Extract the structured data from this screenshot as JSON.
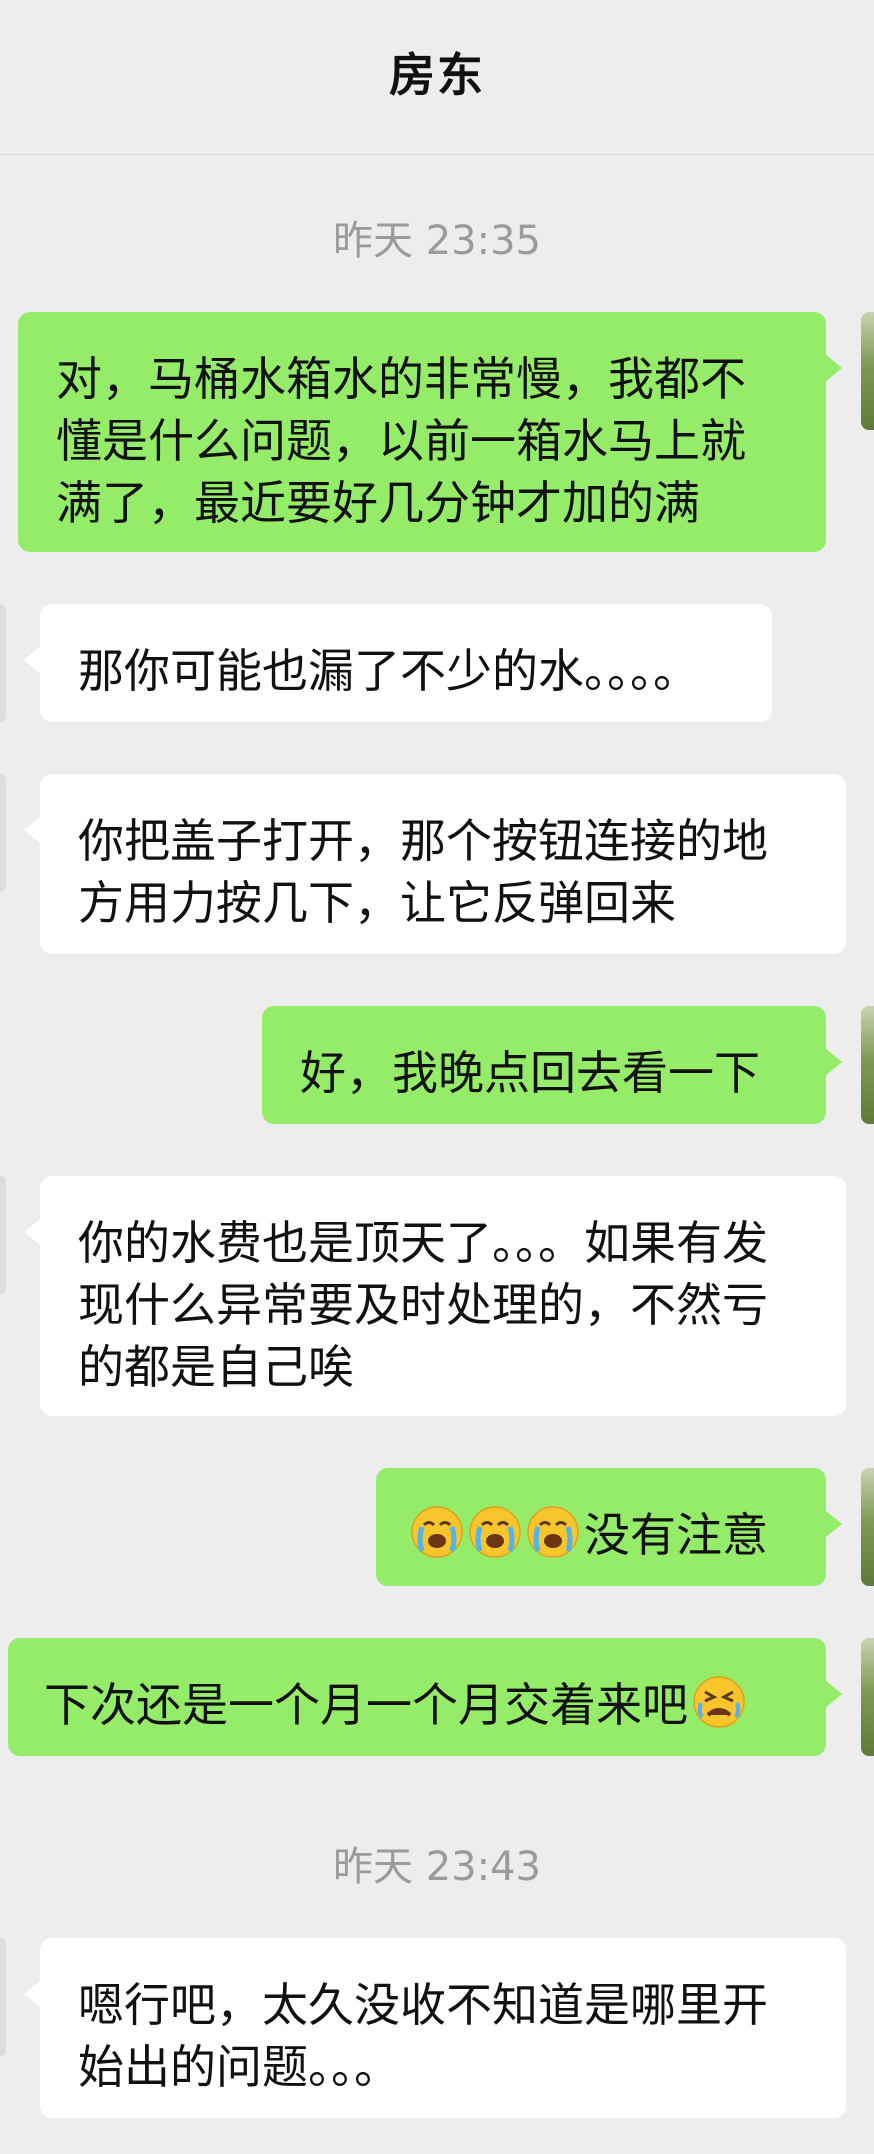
{
  "header": {
    "title": "房东"
  },
  "timestamps": [
    "昨天 23:35",
    "昨天 23:43"
  ],
  "messages": [
    {
      "side": "out",
      "text": "对，马桶水箱水的非常慢，我都不懂是什么问题，以前一箱水马上就满了，最近要好几分钟才加的满"
    },
    {
      "side": "in",
      "text": "那你可能也漏了不少的水。。。。"
    },
    {
      "side": "in",
      "text": "你把盖子打开，那个按钮连接的地方用力按几下，让它反弹回来"
    },
    {
      "side": "out",
      "text": "好，我晚点回去看一下"
    },
    {
      "side": "in",
      "text": "你的水费也是顶天了。。。如果有发现什么异常要及时处理的，不然亏的都是自己唉"
    },
    {
      "side": "out",
      "text": "没有注意",
      "emoji": [
        "crying-face",
        "crying-face",
        "crying-face"
      ]
    },
    {
      "side": "out",
      "text": "下次还是一个月一个月交着来吧",
      "emoji_after": "tired-face"
    },
    {
      "side": "in",
      "text": "嗯行吧，太久没收不知道是哪里开始出的问题。。。"
    }
  ],
  "colors": {
    "outgoing_bubble": "#95ec69",
    "incoming_bubble": "#ffffff",
    "background": "#ededed"
  }
}
